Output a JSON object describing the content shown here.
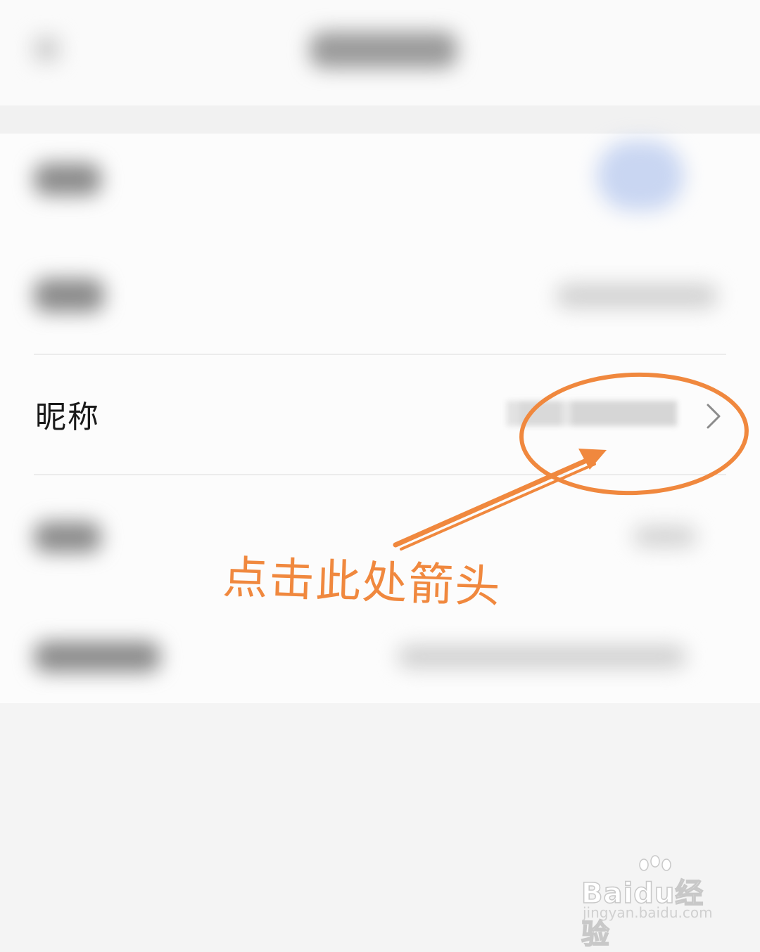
{
  "header": {
    "title": ""
  },
  "profile": {
    "nickname_label": "昵称",
    "nickname_value": ""
  },
  "annotation": {
    "text": "点击此处箭头",
    "color": "#f0883e"
  },
  "watermark": {
    "logo": "Baidu经验",
    "url": "jingyan.baidu.com"
  }
}
